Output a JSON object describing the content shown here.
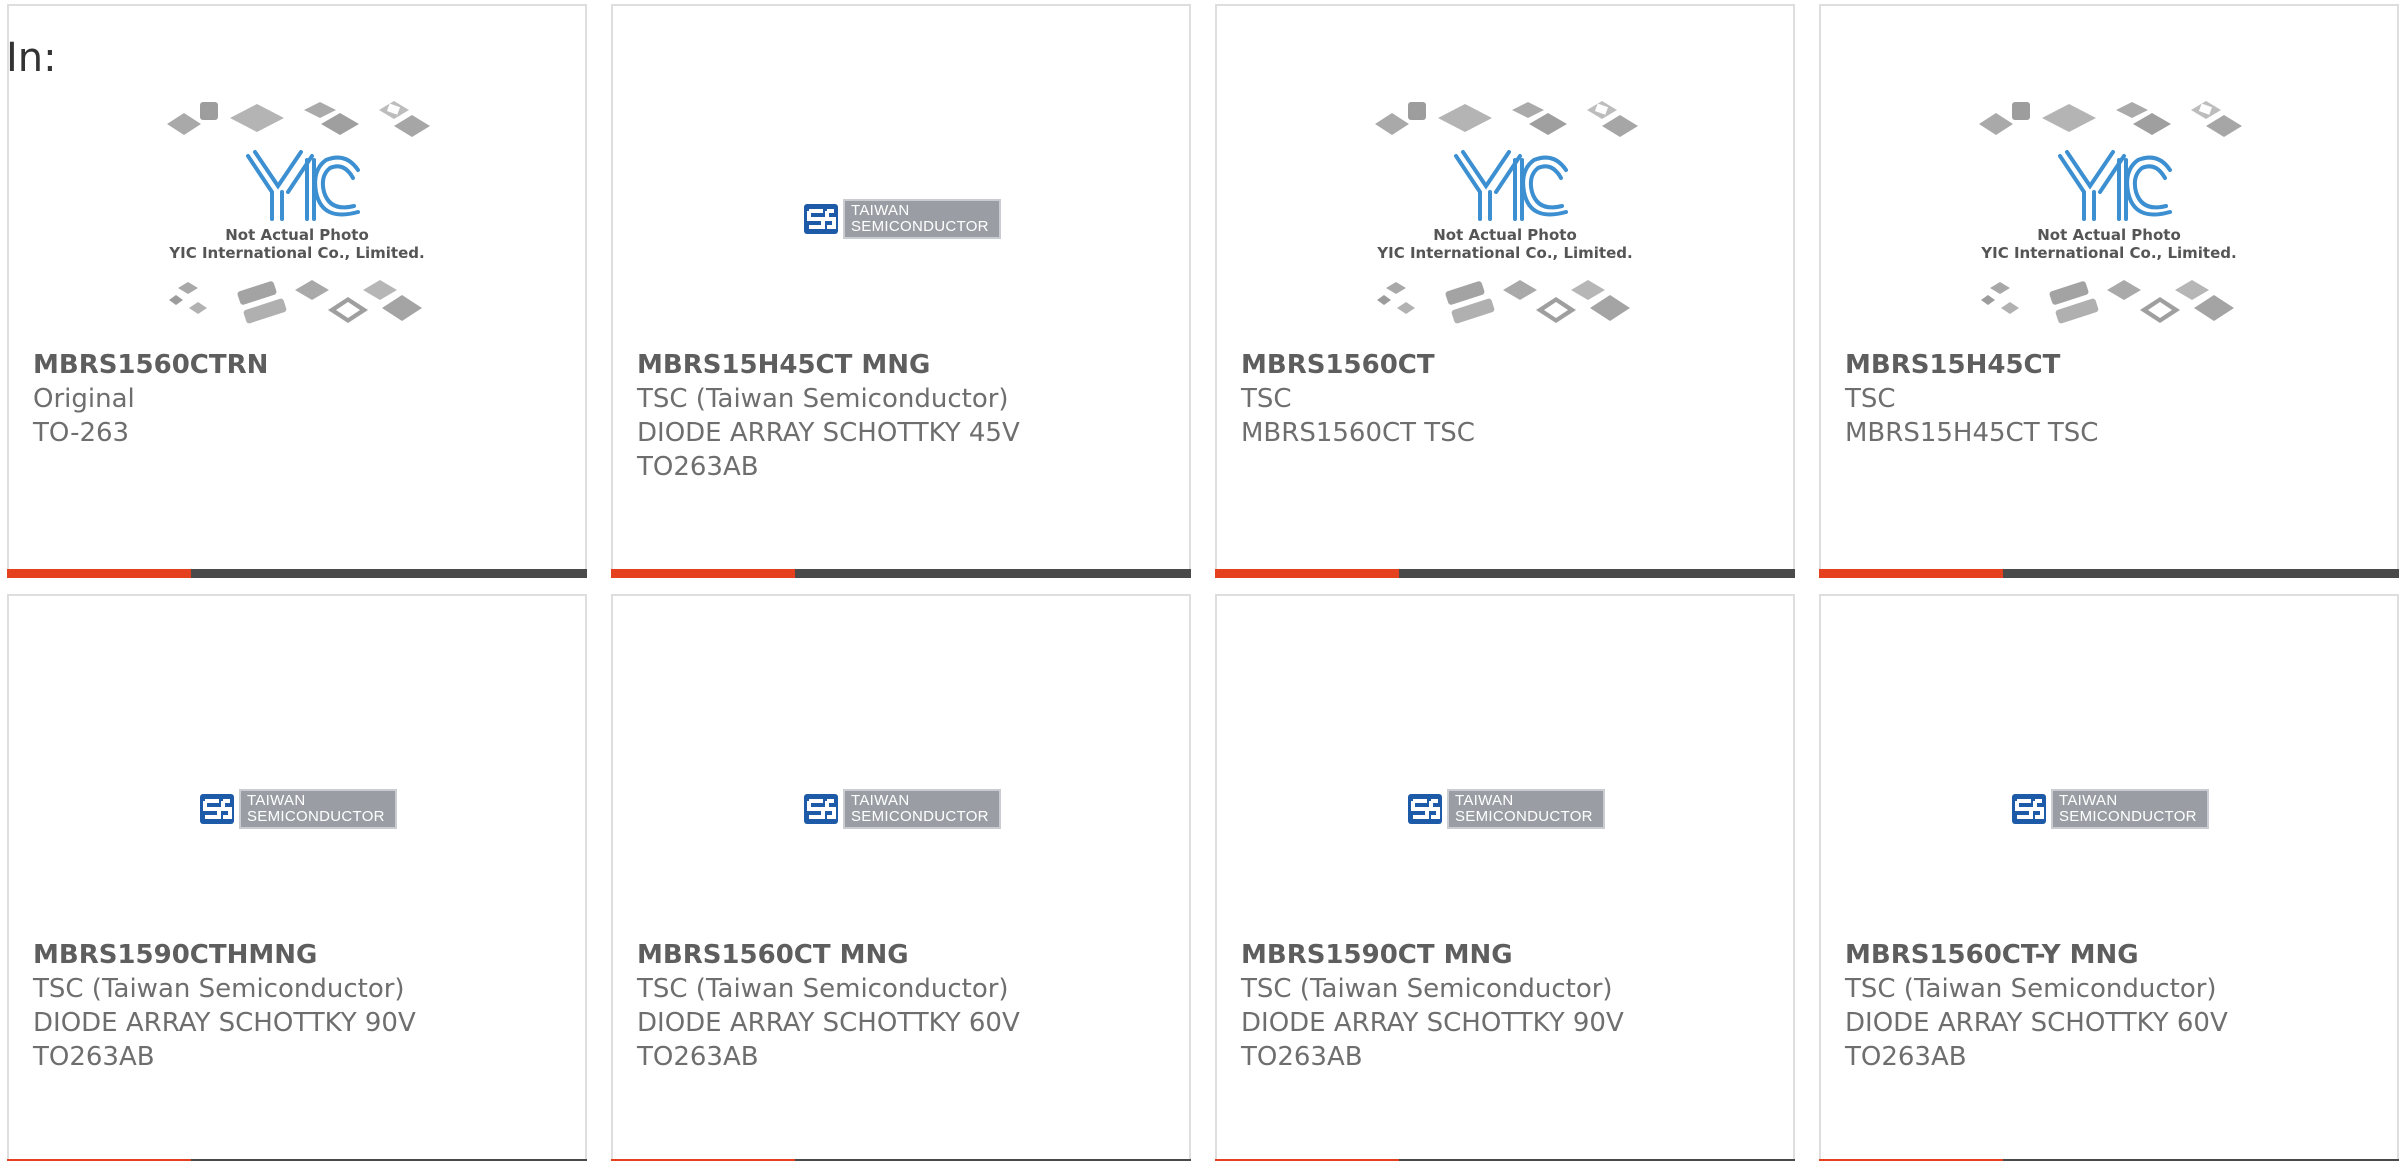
{
  "page": {
    "in_label": "In:"
  },
  "colors": {
    "accent_bar": "#e5411f",
    "dark_bar": "#4a4a4a",
    "tsc_blue": "#1d5aa8"
  },
  "placeholder": {
    "caption_line1": "Not Actual Photo",
    "caption_line2": "YIC International Co., Limited."
  },
  "tsc_logo": {
    "line1": "TAIWAN",
    "line2": "SEMICONDUCTOR"
  },
  "products": [
    {
      "part": "MBRS1560CTRN",
      "image": "yic-placeholder",
      "lines": [
        "Original",
        "TO-263"
      ]
    },
    {
      "part": "MBRS15H45CT MNG",
      "image": "tsc-logo",
      "lines": [
        "TSC (Taiwan Semiconductor)",
        "DIODE ARRAY SCHOTTKY 45V",
        "TO263AB"
      ]
    },
    {
      "part": "MBRS1560CT",
      "image": "yic-placeholder",
      "lines": [
        "TSC",
        "MBRS1560CT TSC"
      ]
    },
    {
      "part": "MBRS15H45CT",
      "image": "yic-placeholder",
      "lines": [
        "TSC",
        "MBRS15H45CT TSC"
      ]
    },
    {
      "part": "MBRS1590CTHMNG",
      "image": "tsc-logo",
      "lines": [
        "TSC (Taiwan Semiconductor)",
        "DIODE ARRAY SCHOTTKY 90V",
        "TO263AB"
      ]
    },
    {
      "part": "MBRS1560CT MNG",
      "image": "tsc-logo",
      "lines": [
        "TSC (Taiwan Semiconductor)",
        "DIODE ARRAY SCHOTTKY 60V",
        "TO263AB"
      ]
    },
    {
      "part": "MBRS1590CT MNG",
      "image": "tsc-logo",
      "lines": [
        "TSC (Taiwan Semiconductor)",
        "DIODE ARRAY SCHOTTKY 90V",
        "TO263AB"
      ]
    },
    {
      "part": "MBRS1560CT-Y MNG",
      "image": "tsc-logo",
      "lines": [
        "TSC (Taiwan Semiconductor)",
        "DIODE ARRAY SCHOTTKY 60V",
        "TO263AB"
      ]
    }
  ]
}
